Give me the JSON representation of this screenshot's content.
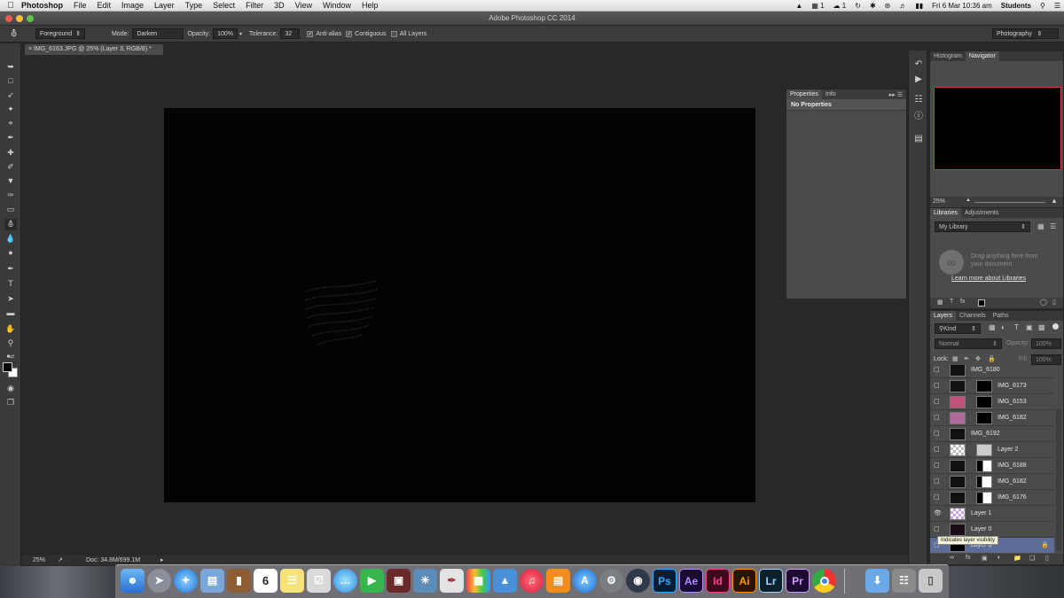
{
  "menubar": {
    "app": "Photoshop",
    "items": [
      "File",
      "Edit",
      "Image",
      "Layer",
      "Type",
      "Select",
      "Filter",
      "3D",
      "View",
      "Window",
      "Help"
    ],
    "status": {
      "badge1": "1",
      "badge2": "1",
      "datetime": "Fri 6 Mar  10:36 am",
      "user": "Students"
    }
  },
  "window": {
    "title": "Adobe Photoshop CC 2014"
  },
  "options": {
    "fill_source": "Foreground",
    "mode_label": "Mode:",
    "mode_value": "Darken",
    "opacity_label": "Opacity:",
    "opacity_value": "100%",
    "tolerance_label": "Tolerance:",
    "tolerance_value": "32",
    "antialias": "Anti-alias",
    "contiguous": "Contiguous",
    "all_layers": "All Layers",
    "workspace": "Photography"
  },
  "document": {
    "tab": "IMG_6163.JPG @ 25% (Layer 3, RGB/8) *",
    "zoom": "25%",
    "doc_size": "Doc: 34.8M/699.1M"
  },
  "properties": {
    "tabs": [
      "Properties",
      "Info"
    ],
    "content": "No Properties"
  },
  "navigator": {
    "tabs": [
      "Histogram",
      "Navigator"
    ],
    "zoom": "25%"
  },
  "libraries": {
    "tabs": [
      "Libraries",
      "Adjustments"
    ],
    "library": "My Library",
    "drag_text_1": "Drag anything here from",
    "drag_text_2": "your document",
    "learn_more": "Learn more about Libraries"
  },
  "layers_panel": {
    "tabs": [
      "Layers",
      "Channels",
      "Paths"
    ],
    "kind": "Kind",
    "blend": "Normal",
    "opacity_label": "Opacity:",
    "opacity_value": "100%",
    "lock_label": "Lock:",
    "fill_label": "Fill:",
    "fill_value": "100%",
    "layers": [
      "IMG_6180",
      "IMG_6173",
      "IMG_6153",
      "IMG_6182",
      "IMG_6192",
      "Layer 2",
      "IMG_6188",
      "IMG_6182",
      "IMG_6176",
      "Layer 1",
      "Layer 0",
      "Layer 3"
    ],
    "tooltip": "Indicates layer visibility"
  },
  "dock": {
    "calendar_day": "6",
    "apps": [
      "Ps",
      "Ae",
      "Id",
      "Ai",
      "Lr",
      "Pr"
    ]
  },
  "colors": {
    "accent_red": "#d23b30",
    "selected_layer": "#5e6d97",
    "canvas": "#030303"
  }
}
